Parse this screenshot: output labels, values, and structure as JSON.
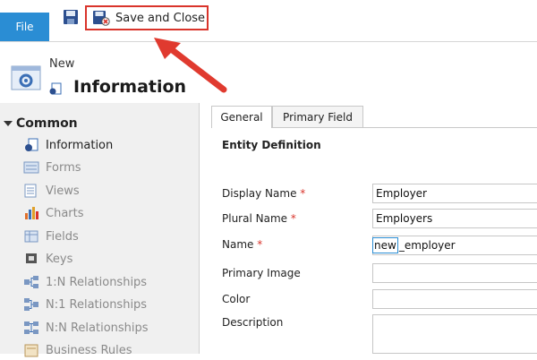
{
  "ribbon": {
    "file_label": "File",
    "save_and_close_label": "Save and Close"
  },
  "header": {
    "new_label": "New",
    "title": "Information"
  },
  "sidebar": {
    "heading": "Common",
    "items": [
      {
        "label": "Information",
        "icon": "info-doc-icon",
        "active": true
      },
      {
        "label": "Forms",
        "icon": "forms-icon"
      },
      {
        "label": "Views",
        "icon": "views-icon"
      },
      {
        "label": "Charts",
        "icon": "charts-icon"
      },
      {
        "label": "Fields",
        "icon": "fields-icon"
      },
      {
        "label": "Keys",
        "icon": "keys-icon"
      },
      {
        "label": "1:N Relationships",
        "icon": "relationship-icon"
      },
      {
        "label": "N:1 Relationships",
        "icon": "relationship-icon"
      },
      {
        "label": "N:N Relationships",
        "icon": "relationship-icon"
      },
      {
        "label": "Business Rules",
        "icon": "business-rules-icon"
      }
    ]
  },
  "tabs": [
    {
      "label": "General",
      "active": true
    },
    {
      "label": "Primary Field"
    }
  ],
  "section_title": "Entity Definition",
  "fields": {
    "display_name": {
      "label": "Display Name",
      "required": "*",
      "value": "Employer"
    },
    "plural_name": {
      "label": "Plural Name",
      "required": "*",
      "value": "Employers"
    },
    "name": {
      "label": "Name",
      "required": "*",
      "prefix": "new",
      "value": "_employer"
    },
    "primary_image": {
      "label": "Primary Image",
      "value": ""
    },
    "color": {
      "label": "Color",
      "value": ""
    },
    "description": {
      "label": "Description",
      "value": ""
    }
  },
  "colors": {
    "file_tab": "#2a8dd4",
    "highlight_red": "#d9342b",
    "required_star": "#d9342b"
  }
}
